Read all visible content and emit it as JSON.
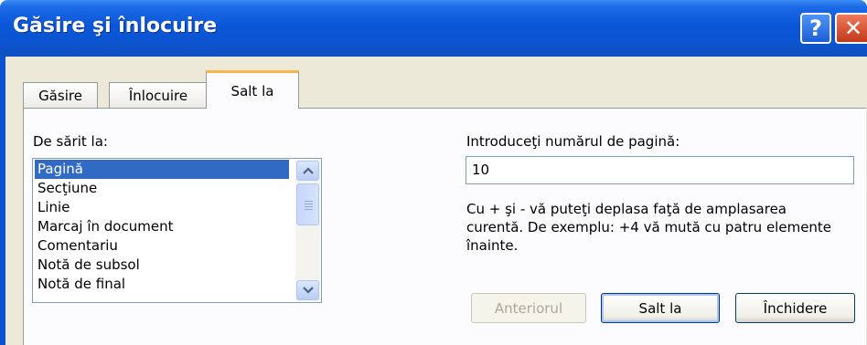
{
  "window": {
    "title": "Găsire şi înlocuire",
    "help_label": "?",
    "close_label": "✕"
  },
  "tabs": [
    {
      "label": "Găsire"
    },
    {
      "label": "Înlocuire"
    },
    {
      "label": "Salt la",
      "selected": true
    }
  ],
  "goto_list": {
    "label": "De sărit la:",
    "items": [
      "Pagină",
      "Secţiune",
      "Linie",
      "Marcaj în document",
      "Comentariu",
      "Notă de subsol",
      "Notă de final"
    ],
    "selected": "Pagină"
  },
  "page_field": {
    "label": "Introduceţi numărul de pagină:",
    "value": "10"
  },
  "hint_text": "Cu + şi - vă puteţi deplasa faţă de amplasarea curentă. De exemplu: +4 vă mută cu patru elemente înainte.",
  "buttons": {
    "previous": "Anteriorul",
    "goto": "Salt la",
    "close": "Închidere"
  },
  "icons": {
    "scroll_up": "chevron-up-icon",
    "scroll_down": "chevron-down-icon"
  },
  "colors": {
    "titlebar": "#0a56d8",
    "selection": "#316ac5",
    "tab_highlight": "#f7b64a",
    "dialog_bg": "#ece9d8"
  }
}
